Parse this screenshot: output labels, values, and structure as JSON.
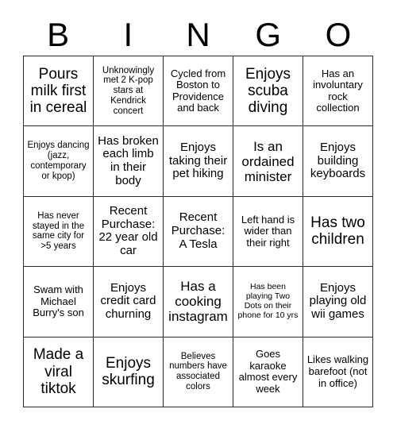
{
  "card": {
    "header_letters": [
      "B",
      "I",
      "N",
      "G",
      "O"
    ],
    "columns": 5,
    "rows": 5,
    "border_color": "#2b2b2b",
    "background_color": "#ffffff",
    "text_color": "#000000",
    "cells": [
      {
        "text": "Pours milk first in cereal",
        "size": "fs-xl",
        "marked": false
      },
      {
        "text": "Unknowingly met 2 K-pop stars at Kendrick concert",
        "size": "fs-xs",
        "marked": false
      },
      {
        "text": "Cycled from Boston to Providence and back",
        "size": "fs-sm",
        "marked": false
      },
      {
        "text": "Enjoys scuba diving",
        "size": "fs-xl",
        "marked": false
      },
      {
        "text": "Has an involuntary rock collection",
        "size": "fs-sm",
        "marked": false
      },
      {
        "text": "Enjoys dancing (jazz, contemporary or kpop)",
        "size": "fs-xs",
        "marked": false
      },
      {
        "text": "Has broken each limb in their body",
        "size": "fs-md",
        "marked": false
      },
      {
        "text": "Enjoys taking their pet hiking",
        "size": "fs-md",
        "marked": false
      },
      {
        "text": "Is an ordained minister",
        "size": "fs-lg",
        "marked": false
      },
      {
        "text": "Enjoys building keyboards",
        "size": "fs-md",
        "marked": false
      },
      {
        "text": "Has never stayed in the same city for >5 years",
        "size": "fs-xs",
        "marked": false
      },
      {
        "text": "Recent Purchase: 22 year old car",
        "size": "fs-md",
        "marked": false
      },
      {
        "text": "Recent Purchase: A Tesla",
        "size": "fs-md",
        "marked": false
      },
      {
        "text": "Left hand is wider than their right",
        "size": "fs-sm",
        "marked": false
      },
      {
        "text": "Has two children",
        "size": "fs-xl",
        "marked": false
      },
      {
        "text": "Swam with Michael Burry's son",
        "size": "fs-sm",
        "marked": false
      },
      {
        "text": "Enjoys credit card churning",
        "size": "fs-md",
        "marked": false
      },
      {
        "text": "Has a cooking instagram",
        "size": "fs-lg",
        "marked": false
      },
      {
        "text": "Has been playing Two Dots on their phone for 10 yrs",
        "size": "fs-xxs",
        "marked": false
      },
      {
        "text": "Enjoys playing old wii games",
        "size": "fs-md",
        "marked": false
      },
      {
        "text": "Made a viral tiktok",
        "size": "fs-xl",
        "marked": false
      },
      {
        "text": "Enjoys skurfing",
        "size": "fs-xl",
        "marked": false
      },
      {
        "text": "Believes numbers have associated colors",
        "size": "fs-xs",
        "marked": false
      },
      {
        "text": "Goes karaoke almost every week",
        "size": "fs-sm",
        "marked": false
      },
      {
        "text": "Likes walking barefoot (not in office)",
        "size": "fs-sm",
        "marked": false
      }
    ]
  }
}
